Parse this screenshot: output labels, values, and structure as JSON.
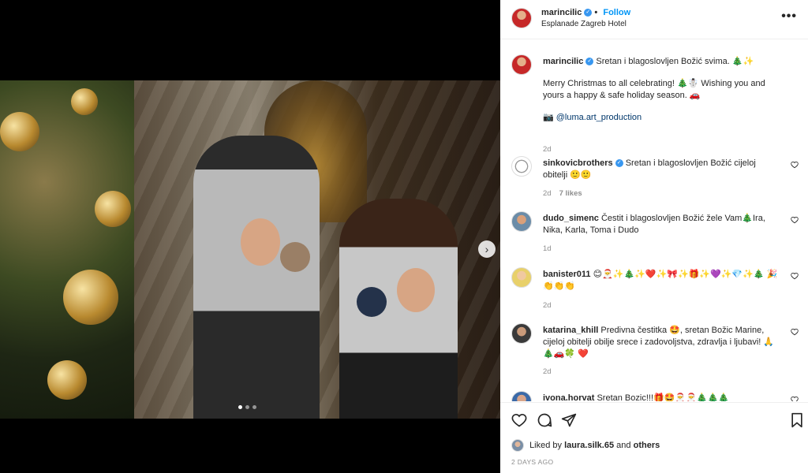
{
  "post": {
    "username": "marincilic",
    "follow_label": "Follow",
    "location": "Esplanade Zagreb Hotel",
    "more_icon": "more-horizontal-icon"
  },
  "caption": {
    "username": "marincilic",
    "line1": "Sretan i blagoslovljen Božić svima. 🎄✨",
    "line2": "Merry Christmas to all celebrating! 🎄☃️ Wishing you and yours a happy & safe holiday season. 🚗",
    "credit": "📷 @luma.art_production",
    "time": "2d"
  },
  "comments": [
    {
      "username": "sinkovicbrothers",
      "verified": true,
      "text": "Sretan i blagoslovljen Božić cijeloj obitelji 🙂🙂",
      "time": "2d",
      "likes": "7 likes"
    },
    {
      "username": "dudo_simenc",
      "verified": false,
      "text": "Čestit i blagoslovljen Božić žele Vam🎄Ira, Nika, Karla, Toma i Dudo",
      "time": "1d",
      "likes": ""
    },
    {
      "username": "banister011",
      "verified": false,
      "text": "😊🎅✨🎄✨❤️✨🎀✨🎁✨💜✨💎✨🎄 🎉👏👏👏",
      "time": "2d",
      "likes": ""
    },
    {
      "username": "katarina_khill",
      "verified": false,
      "text": "Predivna čestitka 🤩, sretan Božic Marine, cijeloj obitelji obilje srece i zadovoljstva, zdravlja i ljubavi! 🙏🎄🚗🍀 ❤️",
      "time": "2d",
      "likes": ""
    },
    {
      "username": "ivona.horvat",
      "verified": false,
      "text": "Sretan Bozic!!!🎁🤩🎅🎅🎄🎄🎄",
      "time": "",
      "likes": ""
    }
  ],
  "actions": {
    "like_icon": "heart-icon",
    "comment_icon": "comment-icon",
    "share_icon": "share-icon",
    "save_icon": "bookmark-icon"
  },
  "likes": {
    "prefix": "Liked by",
    "user": "laura.silk.65",
    "suffix": "and",
    "others": "others"
  },
  "date": "2 DAYS AGO",
  "carousel": {
    "current": 1,
    "total": 3
  }
}
